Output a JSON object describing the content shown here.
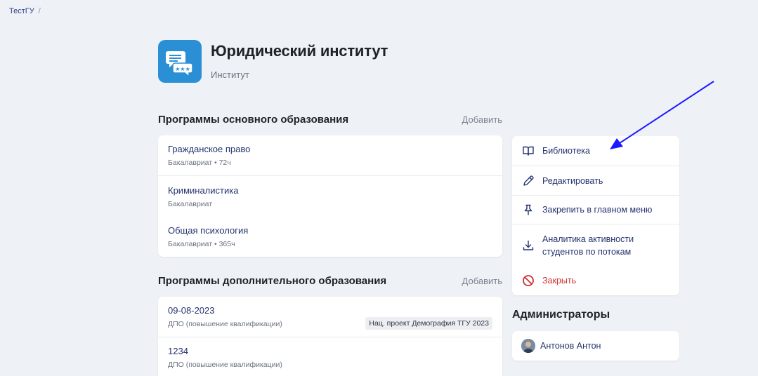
{
  "breadcrumb": {
    "root": "ТестГУ",
    "separator": "/"
  },
  "header": {
    "logo_icon": "chat-bubbles-icon",
    "title": "Юридический институт",
    "subtitle": "Институт"
  },
  "main_programs": {
    "title": "Программы основного образования",
    "add_label": "Добавить",
    "items": [
      {
        "name": "Гражданское право",
        "meta": "Бакалавриат • 72ч"
      },
      {
        "name": "Криминалистика",
        "meta": "Бакалавриат"
      },
      {
        "name": "Общая психология",
        "meta": "Бакалавриат • 365ч"
      }
    ]
  },
  "extra_programs": {
    "title": "Программы дополнительного образования",
    "add_label": "Добавить",
    "items": [
      {
        "name": "09-08-2023",
        "meta": "ДПО (повышение квалификации)",
        "tag": "Нац. проект Демография ТГУ 2023"
      },
      {
        "name": "1234",
        "meta": "ДПО (повышение квалификации)"
      }
    ]
  },
  "actions": [
    {
      "label": "Библиотека",
      "icon": "book-icon"
    },
    {
      "label": "Редактировать",
      "icon": "pencil-icon"
    },
    {
      "label": "Закрепить в главном меню",
      "icon": "pin-icon"
    },
    {
      "label": "Аналитика активности студентов по потокам",
      "icon": "download-icon"
    },
    {
      "label": "Закрыть",
      "icon": "forbidden-icon"
    }
  ],
  "admins": {
    "title": "Администраторы",
    "items": [
      {
        "name": "Антонов Антон"
      }
    ]
  },
  "colors": {
    "accent": "#24336e",
    "danger": "#d0312d",
    "annotation_arrow": "#1a1aff",
    "logo_bg": "#2b8fd6"
  }
}
